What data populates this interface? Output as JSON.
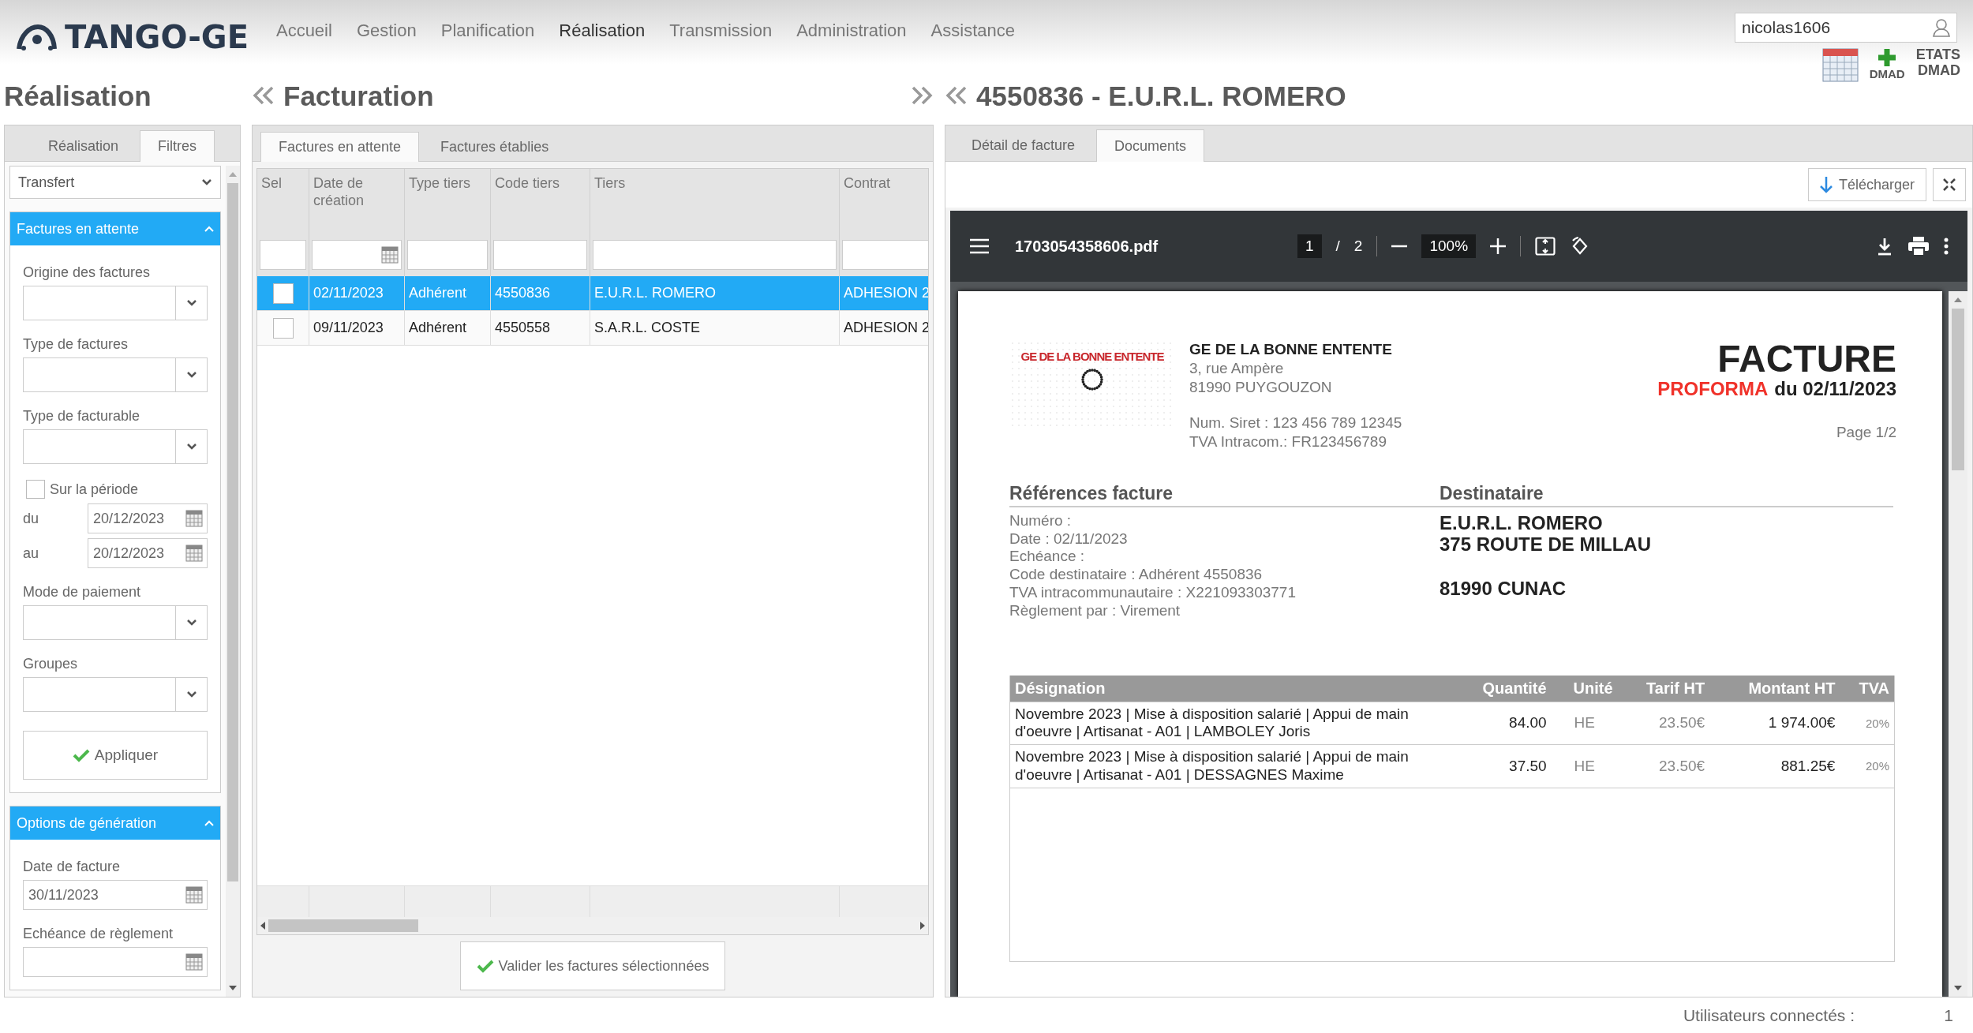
{
  "header": {
    "logo": "TANGO-GE",
    "nav": [
      {
        "label": "Accueil",
        "selected": false
      },
      {
        "label": "Gestion",
        "selected": false
      },
      {
        "label": "Planification",
        "selected": false
      },
      {
        "label": "Réalisation",
        "selected": true
      },
      {
        "label": "Transmission",
        "selected": false
      },
      {
        "label": "Administration",
        "selected": false
      },
      {
        "label": "Assistance",
        "selected": false
      }
    ],
    "user": "nicolas1606",
    "tools": [
      {
        "kind": "calendar"
      },
      {
        "kind": "add",
        "label": "DMAD"
      },
      {
        "kind": "text",
        "lines": [
          "ETATS",
          "DMAD"
        ]
      }
    ]
  },
  "left": {
    "title": "Réalisation",
    "tabs": [
      {
        "label": "Réalisation",
        "selected": false
      },
      {
        "label": "Filtres",
        "selected": true
      }
    ],
    "mode_select": "Transfert",
    "sections": [
      {
        "title": "Factures en attente",
        "expanded": true,
        "fields": [
          {
            "kind": "select",
            "label": "Origine des factures"
          },
          {
            "kind": "select",
            "label": "Type de factures"
          },
          {
            "kind": "select",
            "label": "Type de facturable"
          },
          {
            "kind": "checkbox",
            "label": "Sur la période",
            "checked": false
          },
          {
            "kind": "date_inline",
            "label": "du",
            "value": "20/12/2023"
          },
          {
            "kind": "date_inline",
            "label": "au",
            "value": "20/12/2023"
          },
          {
            "kind": "select",
            "label": "Mode de paiement"
          },
          {
            "kind": "select",
            "label": "Groupes"
          },
          {
            "kind": "button",
            "label": "Appliquer"
          }
        ]
      },
      {
        "title": "Options de génération",
        "expanded": true,
        "fields": [
          {
            "kind": "date",
            "label": "Date de facture",
            "value": "30/11/2023"
          },
          {
            "kind": "date",
            "label": "Echéance de règlement"
          }
        ]
      }
    ]
  },
  "middle": {
    "title": "Facturation",
    "tabs": [
      {
        "label": "Factures en attente",
        "selected": true
      },
      {
        "label": "Factures établies",
        "selected": false
      }
    ],
    "table": {
      "columns": [
        "Sel",
        "Date de création",
        "Type tiers",
        "Code tiers",
        "Tiers",
        "Contrat"
      ],
      "rows": [
        {
          "selected": true,
          "checked": false,
          "cells": [
            "",
            "02/11/2023",
            "Adhérent",
            "4550836",
            "E.U.R.L. ROMERO",
            "ADHESION 2"
          ]
        },
        {
          "selected": false,
          "checked": false,
          "cells": [
            "",
            "09/11/2023",
            "Adhérent",
            "4550558",
            "S.A.R.L. COSTE",
            "ADHESION 2"
          ]
        }
      ]
    },
    "button": "Valider les factures sélectionnées"
  },
  "document": {
    "title": "4550836 - E.U.R.L. ROMERO",
    "tabs": [
      {
        "label": "Détail de facture",
        "selected": false
      },
      {
        "label": "Documents",
        "selected": true
      }
    ],
    "download": "Télécharger",
    "viewer": {
      "filename": "1703054358606.pdf",
      "page": "1",
      "separator": "/",
      "pages": "2",
      "zoom": "100%"
    },
    "invoice": {
      "logo_text": "GE DE LA BONNE ENTENTE",
      "company": "GE DE LA BONNE ENTENTE",
      "address": [
        "3, rue Ampère",
        "81990 PUYGOUZON"
      ],
      "ids": [
        "Num. Siret : 123 456 789 12345",
        "TVA Intracom.: FR123456789"
      ],
      "title": "FACTURE",
      "status": "PROFORMA",
      "date": "du 02/11/2023",
      "page": "Page 1/2",
      "refs_title": "Références facture",
      "refs": [
        "Numéro :",
        "Date : 02/11/2023",
        "Echéance :",
        "Code destinataire : Adhérent 4550836",
        "TVA intracommunautaire : X221093303771",
        "Règlement par : Virement"
      ],
      "dest_title": "Destinataire",
      "dest_name": [
        "E.U.R.L. ROMERO",
        "375 ROUTE DE MILLAU"
      ],
      "dest_city": "81990 CUNAC",
      "columns": [
        "Désignation",
        "Quantité",
        "Unité",
        "Tarif HT",
        "Montant HT",
        "TVA"
      ],
      "rows": [
        [
          "Novembre 2023 | Mise à disposition salarié | Appui de main d'oeuvre | Artisanat - A01 | LAMBOLEY Joris",
          "84.00",
          "HE",
          "23.50€",
          "1 974.00€",
          "20%"
        ],
        [
          "Novembre 2023 | Mise à disposition salarié | Appui de main d'oeuvre | Artisanat - A01 | DESSAGNES Maxime",
          "37.50",
          "HE",
          "23.50€",
          "881.25€",
          "20%"
        ]
      ]
    }
  },
  "status_bar": {
    "label": "Utilisateurs connectés :",
    "value": "1"
  }
}
